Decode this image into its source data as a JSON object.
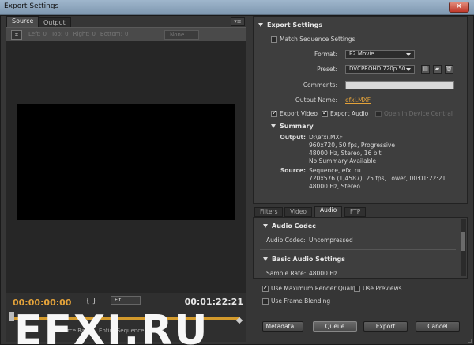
{
  "window": {
    "title": "Export Settings",
    "close_symbol": "✕"
  },
  "left": {
    "tabs": [
      "Source",
      "Output"
    ],
    "panel_menu_symbol": "▾≡",
    "crop": {
      "icon_symbol": "⌗",
      "left_label": "Left:",
      "left": "0",
      "top_label": "Top:",
      "top": "0",
      "right_label": "Right:",
      "right": "0",
      "bottom_label": "Bottom:",
      "bottom": "0",
      "ratio": "None"
    },
    "timecode_current": "00:00:00:00",
    "timecode_duration": "00:01:22:21",
    "fit": "Fit",
    "mark_symbols": "{ }",
    "source_range_label": "Source Range:",
    "source_range_value": "Entire Sequence",
    "watermark": "EFXI.RU"
  },
  "export_settings": {
    "header": "Export Settings",
    "match_sequence_label": "Match Sequence Settings",
    "format_label": "Format:",
    "format": "P2 Movie",
    "preset_label": "Preset:",
    "preset": "DVCPROHD 720p 50",
    "comments_label": "Comments:",
    "comments": "",
    "output_name_label": "Output Name:",
    "output_name": "efxi.MXF",
    "export_video_label": "Export Video",
    "export_audio_label": "Export Audio",
    "open_device_central_label": "Open in Device Central",
    "summary": {
      "header": "Summary",
      "output_label": "Output:",
      "output_lines": [
        "D:\\efxi.MXF",
        "960x720, 50 fps, Progressive",
        "48000 Hz, Stereo, 16 bit",
        "No Summary Available"
      ],
      "source_label": "Source:",
      "source_lines": [
        "Sequence, efxi.ru",
        "720x576 (1,4587), 25 fps, Lower, 00:01:22:21",
        "48000 Hz, Stereo"
      ]
    }
  },
  "settings_tabs": [
    "Filters",
    "Video",
    "Audio",
    "FTP"
  ],
  "audio": {
    "codec_header": "Audio Codec",
    "codec_label": "Audio Codec:",
    "codec_value": "Uncompressed",
    "basic_header": "Basic Audio Settings",
    "sample_rate_label": "Sample Rate:",
    "sample_rate_value": "48000 Hz"
  },
  "options": {
    "max_render_quality": "Use Maximum Render Quality",
    "use_previews": "Use Previews",
    "frame_blending": "Use Frame Blending"
  },
  "buttons": {
    "metadata": "Metadata...",
    "queue": "Queue",
    "export": "Export",
    "cancel": "Cancel"
  },
  "preset_icons": {
    "save": "▤",
    "import": "▰",
    "delete": "🗑"
  }
}
